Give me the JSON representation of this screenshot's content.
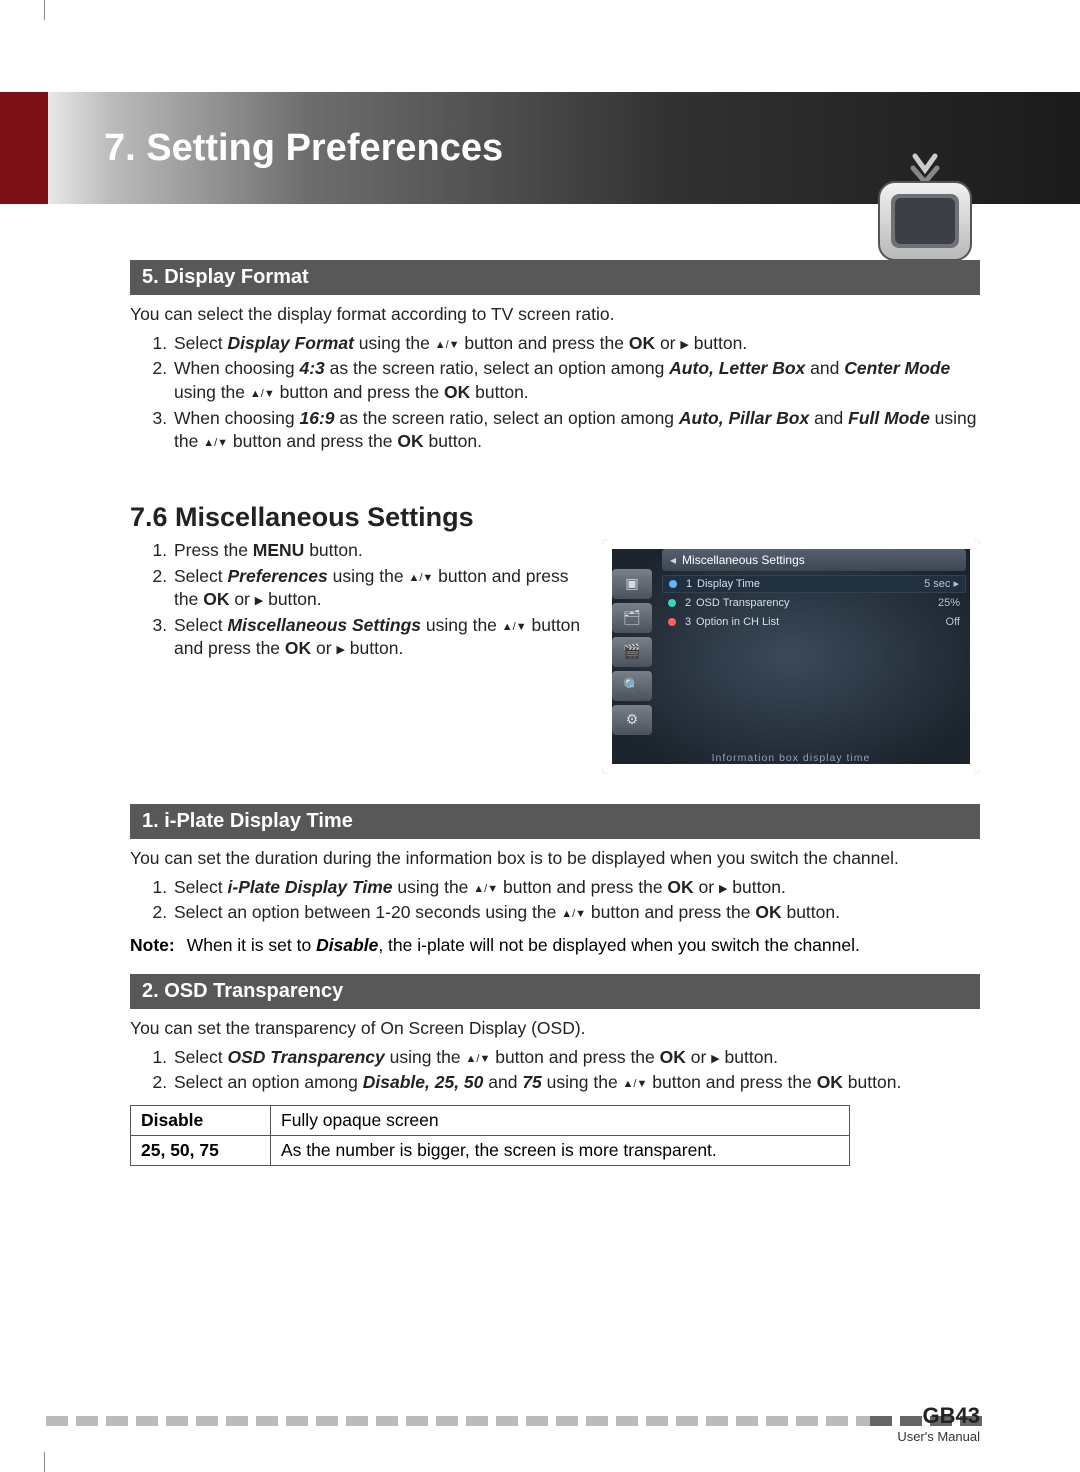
{
  "chapter_title": "7. Setting Preferences",
  "sections": {
    "display_format": {
      "heading": "5. Display Format",
      "intro": "You can select the display format according to TV screen ratio.",
      "steps": [
        {
          "pre": "Select ",
          "bold1": "Display Format",
          "mid1": " using the ",
          "arrows": "▲/▼",
          "mid2": " button and press the ",
          "bold2": "OK",
          "mid3": " or ",
          "tri": "▶",
          "post": " button."
        },
        {
          "pre": "When choosing ",
          "bold1": "4:3",
          "mid1": " as the screen ratio, select an option among ",
          "bold2": "Auto, Letter Box",
          "mid2": " and ",
          "bold3": "Center Mode",
          "mid3": " using the ",
          "arrows": "▲/▼",
          "mid4": " button and press the ",
          "bold4": "OK",
          "post": " button."
        },
        {
          "pre": "When choosing ",
          "bold1": "16:9",
          "mid1": " as the screen ratio, select an option among ",
          "bold2": "Auto, Pillar Box",
          "mid2": " and ",
          "bold3": "Full Mode",
          "mid3": " using the ",
          "arrows": "▲/▼",
          "mid4": " button and press the ",
          "bold4": "OK",
          "post": " button."
        }
      ]
    },
    "misc": {
      "heading": "7.6 Miscellaneous Settings",
      "steps": [
        {
          "pre": "Press the ",
          "bold1": "MENU",
          "post": " button."
        },
        {
          "pre": "Select ",
          "bold1": "Preferences",
          "mid1": " using the ",
          "arrows": "▲/▼",
          "mid2": " button and press the ",
          "bold2": "OK",
          "mid3": " or ",
          "tri": "▶",
          "post": " button."
        },
        {
          "pre": "Select ",
          "bold1": "Miscellaneous Settings",
          "mid1": " using the ",
          "arrows": "▲/▼",
          "mid2": " button and press the ",
          "bold2": "OK",
          "mid3": " or ",
          "tri": "▶",
          "post": " button."
        }
      ],
      "screenshot": {
        "title": "Miscellaneous Settings",
        "rows": [
          {
            "n": "1",
            "label": "Display Time",
            "value": "5 sec ▸",
            "sel": true
          },
          {
            "n": "2",
            "label": "OSD Transparency",
            "value": "25%"
          },
          {
            "n": "3",
            "label": "Option in CH List",
            "value": "Off"
          }
        ],
        "footer": "Information box display time"
      }
    },
    "iplate": {
      "heading": "1. i-Plate Display Time",
      "intro": "You can set the duration during the information box is to be displayed when you switch the channel.",
      "steps": [
        {
          "pre": "Select ",
          "bold1": "i-Plate Display Time",
          "mid1": " using the ",
          "arrows": "▲/▼",
          "mid2": " button and press the ",
          "bold2": "OK",
          "mid3": " or ",
          "tri": "▶",
          "post": " button."
        },
        {
          "pre": "Select an option between 1-20 seconds using the ",
          "arrows": "▲/▼",
          "mid1": " button and press the ",
          "bold1": "OK",
          "post": " button."
        }
      ],
      "note_label": "Note:",
      "note_pre": "When it is set to ",
      "note_bold": "Disable",
      "note_post": ", the i-plate will not be displayed when you switch the channel."
    },
    "osd": {
      "heading": "2. OSD Transparency",
      "intro": "You can set the transparency of On Screen Display (OSD).",
      "steps": [
        {
          "pre": "Select ",
          "bold1": "OSD Transparency",
          "mid1": " using the ",
          "arrows": "▲/▼",
          "mid2": " button and press the ",
          "bold2": "OK",
          "mid3": " or ",
          "tri": "▶",
          "post": " button."
        },
        {
          "pre": "Select an option among ",
          "bold1": "Disable, 25, 50",
          "mid1": " and ",
          "bold2": "75",
          "mid2": " using the ",
          "arrows": "▲/▼",
          "mid3": " button and press the ",
          "bold3": "OK",
          "post": " button."
        }
      ],
      "table": [
        {
          "key": "Disable",
          "val": "Fully opaque screen"
        },
        {
          "key": "25, 50, 75",
          "val": "As the number is bigger, the screen is more transparent."
        }
      ]
    }
  },
  "footer": {
    "page": "GB43",
    "sub": "User's Manual"
  }
}
